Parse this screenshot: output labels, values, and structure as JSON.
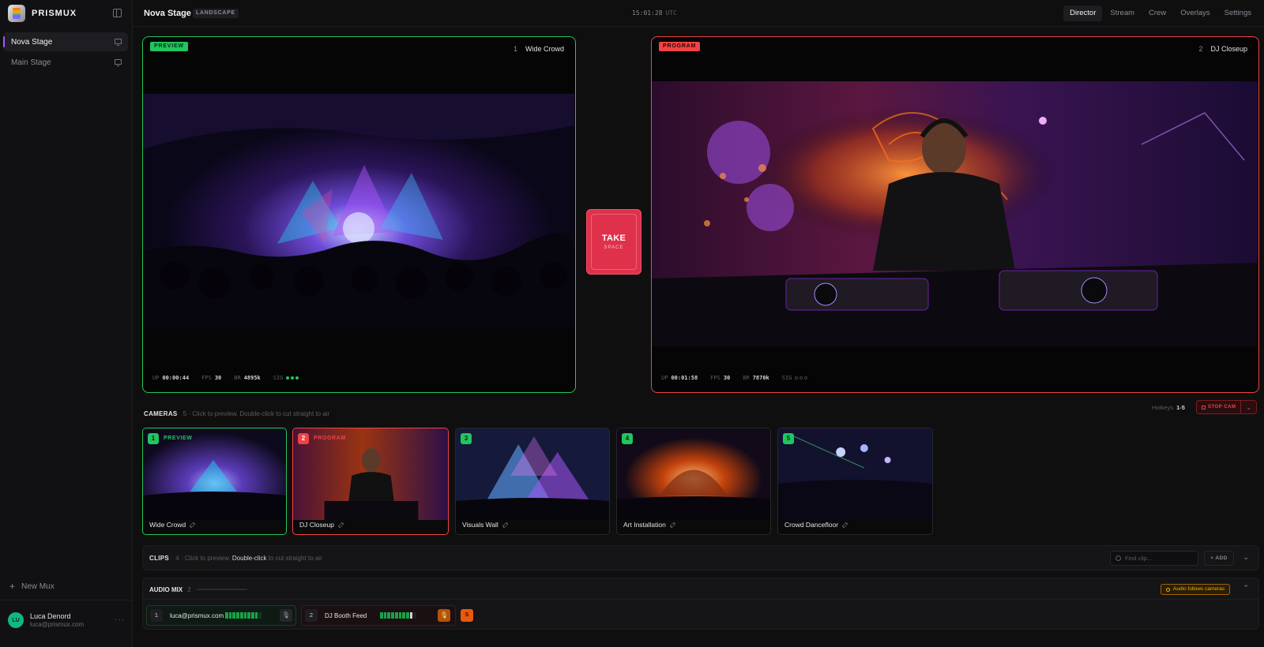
{
  "app": {
    "brand": "PRISMUX"
  },
  "sidebar": {
    "items": [
      {
        "label": "Nova Stage",
        "active": true
      },
      {
        "label": "Main Stage",
        "active": false
      }
    ],
    "new_mux": "New Mux",
    "user": {
      "initials": "LU",
      "name": "Luca Denord",
      "email": "luca@prismux.com"
    }
  },
  "topbar": {
    "title": "Nova Stage",
    "orientation": "LANDSCAPE",
    "clock": "15:01:28",
    "timezone": "UTC",
    "tabs": [
      "Director",
      "Stream",
      "Crew",
      "Overlays",
      "Settings"
    ],
    "active_tab": "Director"
  },
  "preview": {
    "badge": "PREVIEW",
    "source_num": "1",
    "source_name": "Wide Crowd",
    "uptime_label": "UP",
    "uptime": "00:00:44",
    "fps_label": "FPS",
    "fps": "30",
    "br_label": "BR",
    "br": "4895k",
    "sig_label": "SIG"
  },
  "program": {
    "badge": "PROGRAM",
    "source_num": "2",
    "source_name": "DJ Closeup",
    "uptime_label": "UP",
    "uptime": "00:01:58",
    "fps_label": "FPS",
    "fps": "30",
    "br_label": "BR",
    "br": "7870k",
    "sig_label": "SIG"
  },
  "take": {
    "label": "TAKE",
    "key": "SPACE"
  },
  "cameras": {
    "title": "CAMERAS",
    "count": "5",
    "hint": "· Click to preview. Double-click to cut straight to air",
    "hotkeys_label": "Hotkeys",
    "hotkeys_range": "1-5",
    "stop_label": "STOP CAM",
    "items": [
      {
        "num": "1",
        "state": "PREVIEW",
        "name": "Wide Crowd"
      },
      {
        "num": "2",
        "state": "PROGRAM",
        "name": "DJ Closeup"
      },
      {
        "num": "3",
        "state": "",
        "name": "Visuals Wall"
      },
      {
        "num": "4",
        "state": "",
        "name": "Art Installation"
      },
      {
        "num": "5",
        "state": "",
        "name": "Crowd Dancefloor"
      }
    ]
  },
  "clips": {
    "title": "CLIPS",
    "count": "4",
    "hint_a": "· Click to preview.",
    "hint_b": "Double-click",
    "hint_c": "to cut straight to air",
    "search_placeholder": "Find clip...",
    "add_label": "+ ADD"
  },
  "audio": {
    "title": "AUDIO MIX",
    "count": "2",
    "follow_label": "Audio follows cameras",
    "channels": [
      {
        "num": "1",
        "name": "luca@prismux.com"
      },
      {
        "num": "2",
        "name": "DJ Booth Feed"
      }
    ],
    "solo_label": "S"
  },
  "colors": {
    "preview": "#22c55e",
    "program": "#ef4444",
    "take": "#e0314b",
    "accent": "#a855f7"
  }
}
